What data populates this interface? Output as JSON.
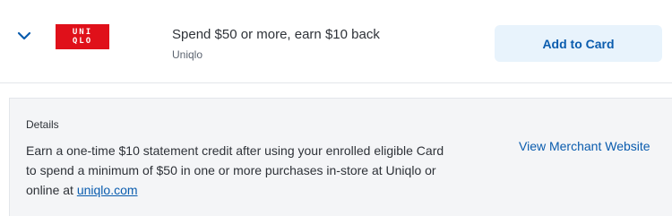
{
  "offer": {
    "logo_line1": "UNI",
    "logo_line2": "QLO",
    "title": "Spend $50 or more, earn $10 back",
    "merchant": "Uniqlo",
    "add_button_label": "Add to Card",
    "expanded": true
  },
  "details": {
    "heading": "Details",
    "text_before_link": "Earn a one-time $10 statement credit after using your enrolled eligible Card to spend a minimum of $50 in one or more purchases in-store at Uniqlo or online at ",
    "link_text": "uniqlo.com",
    "merchant_link_label": "View Merchant Website"
  },
  "colors": {
    "brand_red": "#e0101a",
    "link_blue": "#0a5cae",
    "button_bg": "#e8f3fc",
    "panel_bg": "#f4f5f7"
  },
  "icons": {
    "expand": "chevron-down-icon"
  }
}
